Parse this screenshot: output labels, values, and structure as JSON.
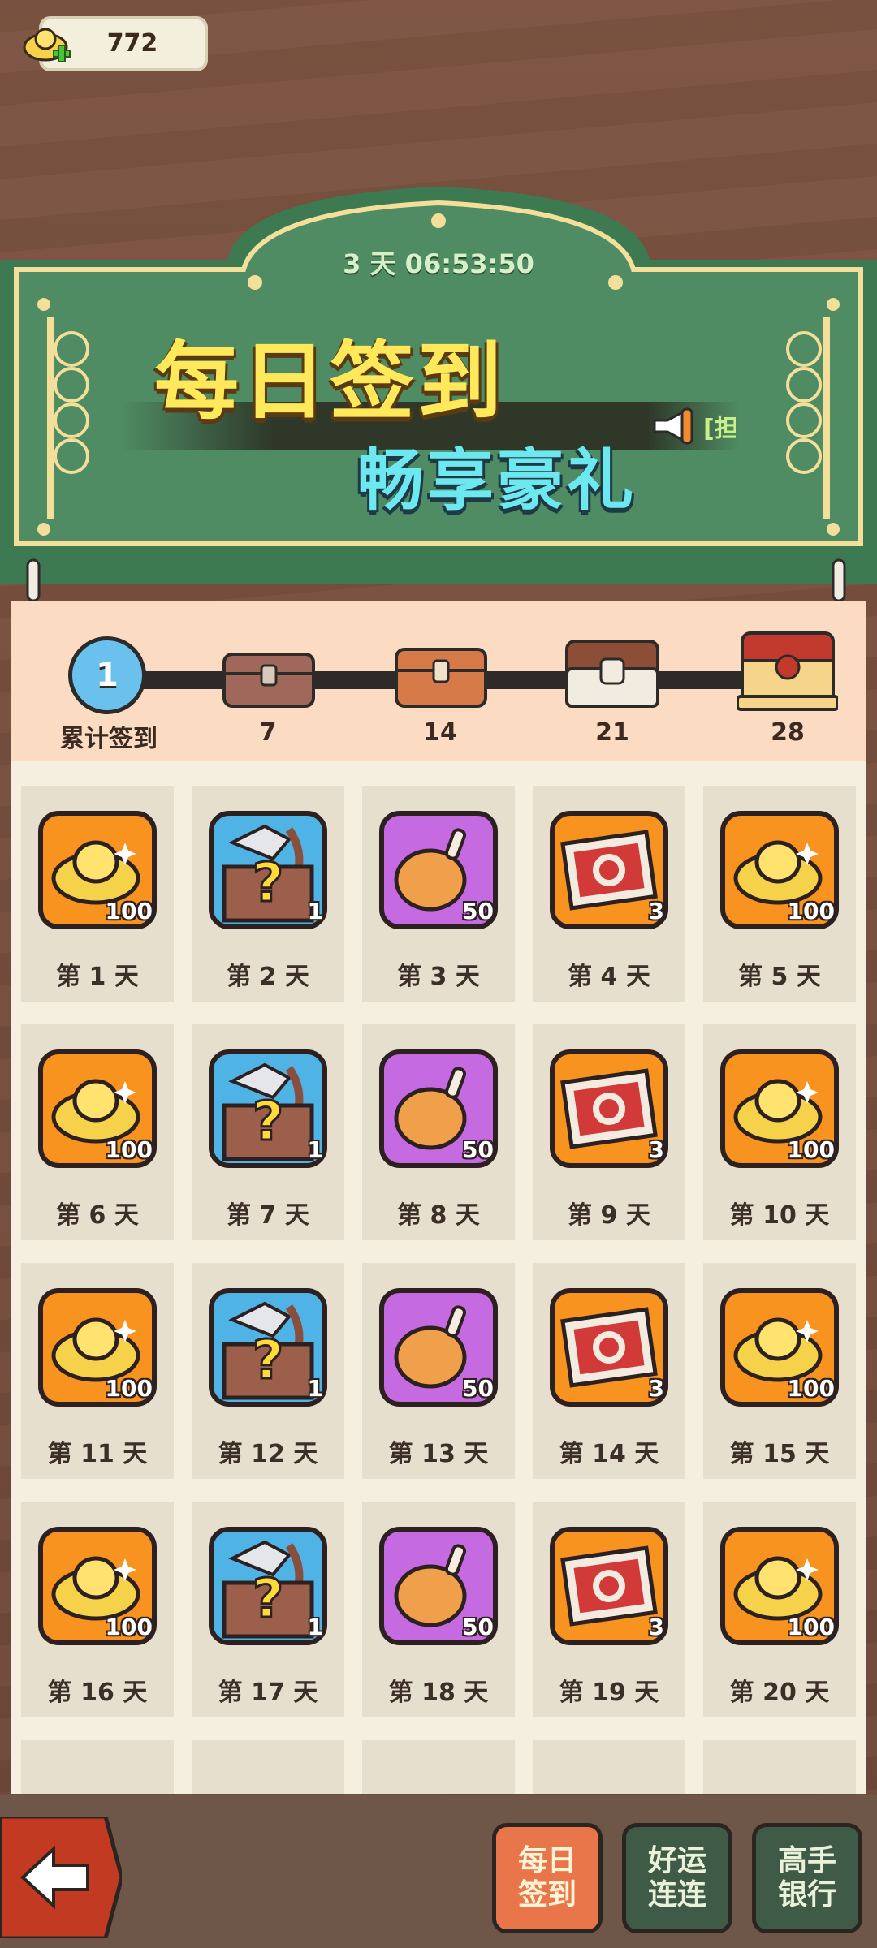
{
  "currency": {
    "amount": "772"
  },
  "banner": {
    "timer": "3 天 06:53:50",
    "title": "每日签到",
    "subtitle": "畅享豪礼",
    "announcement": "[担"
  },
  "progress": {
    "current": "1",
    "current_label": "累计签到",
    "milestones": [
      "7",
      "14",
      "21",
      "28"
    ]
  },
  "rewards": [
    {
      "day": "第 1 天",
      "type": "gold",
      "qty": "100"
    },
    {
      "day": "第 2 天",
      "type": "mystery-box",
      "qty": "1"
    },
    {
      "day": "第 3 天",
      "type": "chicken-leg",
      "qty": "50"
    },
    {
      "day": "第 4 天",
      "type": "ticket",
      "qty": "3"
    },
    {
      "day": "第 5 天",
      "type": "gold",
      "qty": "100"
    },
    {
      "day": "第 6 天",
      "type": "gold",
      "qty": "100"
    },
    {
      "day": "第 7 天",
      "type": "mystery-box",
      "qty": "1"
    },
    {
      "day": "第 8 天",
      "type": "chicken-leg",
      "qty": "50"
    },
    {
      "day": "第 9 天",
      "type": "ticket",
      "qty": "3"
    },
    {
      "day": "第 10 天",
      "type": "gold",
      "qty": "100"
    },
    {
      "day": "第 11 天",
      "type": "gold",
      "qty": "100"
    },
    {
      "day": "第 12 天",
      "type": "mystery-box",
      "qty": "1"
    },
    {
      "day": "第 13 天",
      "type": "chicken-leg",
      "qty": "50"
    },
    {
      "day": "第 14 天",
      "type": "ticket",
      "qty": "3"
    },
    {
      "day": "第 15 天",
      "type": "gold",
      "qty": "100"
    },
    {
      "day": "第 16 天",
      "type": "gold",
      "qty": "100"
    },
    {
      "day": "第 17 天",
      "type": "mystery-box",
      "qty": "1"
    },
    {
      "day": "第 18 天",
      "type": "chicken-leg",
      "qty": "50"
    },
    {
      "day": "第 19 天",
      "type": "ticket",
      "qty": "3"
    },
    {
      "day": "第 20 天",
      "type": "gold",
      "qty": "100"
    }
  ],
  "nav": {
    "daily_label": "每日签到",
    "luck_label": "好运连连",
    "bank_label": "高手银行"
  },
  "colors": {
    "banner_green": "#3f7a55",
    "gold_tile": "#f7931e",
    "mystery_tile": "#4fb3e6",
    "chicken_tile": "#c56ae0",
    "active_nav": "#e9764a",
    "inactive_nav": "#3f5a47"
  }
}
